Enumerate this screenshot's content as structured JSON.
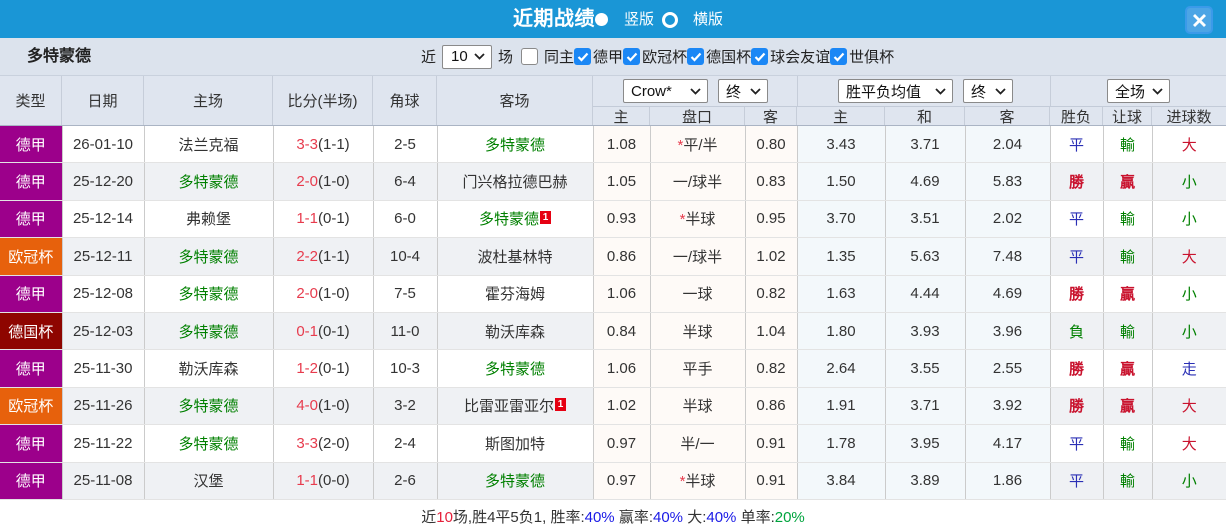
{
  "titlebar": {
    "title": "近期战绩",
    "view_vertical": "竖版",
    "view_horizontal": "横版",
    "bar_color": "#1a96d6"
  },
  "filterbar": {
    "team": "多特蒙德",
    "near_label": "近",
    "match_count": "10",
    "unit_label": "场",
    "same_venue_label": "同主",
    "league_filters": [
      {
        "label": "德甲",
        "checked": true
      },
      {
        "label": "欧冠杯",
        "checked": true
      },
      {
        "label": "德国杯",
        "checked": true
      },
      {
        "label": "球会友谊",
        "checked": true
      },
      {
        "label": "世俱杯",
        "checked": true
      }
    ]
  },
  "table": {
    "left_headers": [
      "类型",
      "日期",
      "主场",
      "比分(半场)",
      "角球",
      "客场"
    ],
    "dropdowns": [
      {
        "label": "Crow*"
      },
      {
        "label": "终"
      },
      {
        "label": "胜平负均值"
      },
      {
        "label": "终"
      },
      {
        "label": "全场"
      }
    ],
    "sub_headers": [
      "主",
      "盘口",
      "客",
      "主",
      "和",
      "客",
      "胜负",
      "让球",
      "进球数"
    ],
    "league_colors": {
      "德甲": "#9c008b",
      "欧冠杯": "#e7610c",
      "德国杯": "#8e0500"
    },
    "result_colors": {
      "red": "#c9132e",
      "blue": "#2a2fb5",
      "green": "#008000"
    },
    "rows": [
      {
        "type": "德甲",
        "date": "26-01-10",
        "home": "法兰克福",
        "home_subject": false,
        "home_card": "",
        "score": "3-3",
        "half": "(1-1)",
        "corners": "2-5",
        "away": "多特蒙德",
        "away_subject": true,
        "away_card": "",
        "crow_home": "1.08",
        "handicap": "平/半",
        "handicap_star": true,
        "crow_away": "0.80",
        "avg_home": "3.43",
        "avg_draw": "3.71",
        "avg_away": "2.04",
        "result": "平",
        "result_color": "blue",
        "handicap_result": "輸",
        "handicap_result_color": "green",
        "goals": "大",
        "goals_color": "red"
      },
      {
        "type": "德甲",
        "date": "25-12-20",
        "home": "多特蒙德",
        "home_subject": true,
        "home_card": "",
        "score": "2-0",
        "half": "(1-0)",
        "corners": "6-4",
        "away": "门兴格拉德巴赫",
        "away_subject": false,
        "away_card": "",
        "crow_home": "1.05",
        "handicap": "一/球半",
        "handicap_star": false,
        "crow_away": "0.83",
        "avg_home": "1.50",
        "avg_draw": "4.69",
        "avg_away": "5.83",
        "result": "勝",
        "result_color": "red",
        "handicap_result": "贏",
        "handicap_result_color": "red",
        "goals": "小",
        "goals_color": "green"
      },
      {
        "type": "德甲",
        "date": "25-12-14",
        "home": "弗赖堡",
        "home_subject": false,
        "home_card": "",
        "score": "1-1",
        "half": "(0-1)",
        "corners": "6-0",
        "away": "多特蒙德",
        "away_subject": true,
        "away_card": "1",
        "crow_home": "0.93",
        "handicap": "半球",
        "handicap_star": true,
        "crow_away": "0.95",
        "avg_home": "3.70",
        "avg_draw": "3.51",
        "avg_away": "2.02",
        "result": "平",
        "result_color": "blue",
        "handicap_result": "輸",
        "handicap_result_color": "green",
        "goals": "小",
        "goals_color": "green"
      },
      {
        "type": "欧冠杯",
        "date": "25-12-11",
        "home": "多特蒙德",
        "home_subject": true,
        "home_card": "",
        "score": "2-2",
        "half": "(1-1)",
        "corners": "10-4",
        "away": "波杜基林特",
        "away_subject": false,
        "away_card": "",
        "crow_home": "0.86",
        "handicap": "一/球半",
        "handicap_star": false,
        "crow_away": "1.02",
        "avg_home": "1.35",
        "avg_draw": "5.63",
        "avg_away": "7.48",
        "result": "平",
        "result_color": "blue",
        "handicap_result": "輸",
        "handicap_result_color": "green",
        "goals": "大",
        "goals_color": "red"
      },
      {
        "type": "德甲",
        "date": "25-12-08",
        "home": "多特蒙德",
        "home_subject": true,
        "home_card": "",
        "score": "2-0",
        "half": "(1-0)",
        "corners": "7-5",
        "away": "霍芬海姆",
        "away_subject": false,
        "away_card": "",
        "crow_home": "1.06",
        "handicap": "一球",
        "handicap_star": false,
        "crow_away": "0.82",
        "avg_home": "1.63",
        "avg_draw": "4.44",
        "avg_away": "4.69",
        "result": "勝",
        "result_color": "red",
        "handicap_result": "贏",
        "handicap_result_color": "red",
        "goals": "小",
        "goals_color": "green"
      },
      {
        "type": "德国杯",
        "date": "25-12-03",
        "home": "多特蒙德",
        "home_subject": true,
        "home_card": "",
        "score": "0-1",
        "half": "(0-1)",
        "corners": "11-0",
        "away": "勒沃库森",
        "away_subject": false,
        "away_card": "",
        "crow_home": "0.84",
        "handicap": "半球",
        "handicap_star": false,
        "crow_away": "1.04",
        "avg_home": "1.80",
        "avg_draw": "3.93",
        "avg_away": "3.96",
        "result": "負",
        "result_color": "green",
        "handicap_result": "輸",
        "handicap_result_color": "green",
        "goals": "小",
        "goals_color": "green"
      },
      {
        "type": "德甲",
        "date": "25-11-30",
        "home": "勒沃库森",
        "home_subject": false,
        "home_card": "",
        "score": "1-2",
        "half": "(0-1)",
        "corners": "10-3",
        "away": "多特蒙德",
        "away_subject": true,
        "away_card": "",
        "crow_home": "1.06",
        "handicap": "平手",
        "handicap_star": false,
        "crow_away": "0.82",
        "avg_home": "2.64",
        "avg_draw": "3.55",
        "avg_away": "2.55",
        "result": "勝",
        "result_color": "red",
        "handicap_result": "贏",
        "handicap_result_color": "red",
        "goals": "走",
        "goals_color": "blue"
      },
      {
        "type": "欧冠杯",
        "date": "25-11-26",
        "home": "多特蒙德",
        "home_subject": true,
        "home_card": "",
        "score": "4-0",
        "half": "(1-0)",
        "corners": "3-2",
        "away": "比雷亚雷亚尔",
        "away_subject": false,
        "away_card": "1",
        "crow_home": "1.02",
        "handicap": "半球",
        "handicap_star": false,
        "crow_away": "0.86",
        "avg_home": "1.91",
        "avg_draw": "3.71",
        "avg_away": "3.92",
        "result": "勝",
        "result_color": "red",
        "handicap_result": "贏",
        "handicap_result_color": "red",
        "goals": "大",
        "goals_color": "red"
      },
      {
        "type": "德甲",
        "date": "25-11-22",
        "home": "多特蒙德",
        "home_subject": true,
        "home_card": "",
        "score": "3-3",
        "half": "(2-0)",
        "corners": "2-4",
        "away": "斯图加特",
        "away_subject": false,
        "away_card": "",
        "crow_home": "0.97",
        "handicap": "半/一",
        "handicap_star": false,
        "crow_away": "0.91",
        "avg_home": "1.78",
        "avg_draw": "3.95",
        "avg_away": "4.17",
        "result": "平",
        "result_color": "blue",
        "handicap_result": "輸",
        "handicap_result_color": "green",
        "goals": "大",
        "goals_color": "red"
      },
      {
        "type": "德甲",
        "date": "25-11-08",
        "home": "汉堡",
        "home_subject": false,
        "home_card": "",
        "score": "1-1",
        "half": "(0-0)",
        "corners": "2-6",
        "away": "多特蒙德",
        "away_subject": true,
        "away_card": "",
        "crow_home": "0.97",
        "handicap": "半球",
        "handicap_star": true,
        "crow_away": "0.91",
        "avg_home": "3.84",
        "avg_draw": "3.89",
        "avg_away": "1.86",
        "result": "平",
        "result_color": "blue",
        "handicap_result": "輸",
        "handicap_result_color": "green",
        "goals": "小",
        "goals_color": "green"
      }
    ]
  },
  "footer": {
    "segments": [
      {
        "text": "近",
        "color": "dark"
      },
      {
        "text": "10",
        "color": "red"
      },
      {
        "text": "场,胜4平5负1, 胜率:",
        "color": "dark"
      },
      {
        "text": "40%",
        "color": "blue"
      },
      {
        "text": " 赢率:",
        "color": "dark"
      },
      {
        "text": "40%",
        "color": "blue"
      },
      {
        "text": " 大:",
        "color": "dark"
      },
      {
        "text": "40%",
        "color": "blue"
      },
      {
        "text": " 单率:",
        "color": "dark"
      },
      {
        "text": "20%",
        "color": "green"
      }
    ],
    "colors": {
      "dark": "#333333",
      "red": "#e5203a",
      "blue": "#1a1ae6",
      "green": "#00a43e"
    }
  }
}
